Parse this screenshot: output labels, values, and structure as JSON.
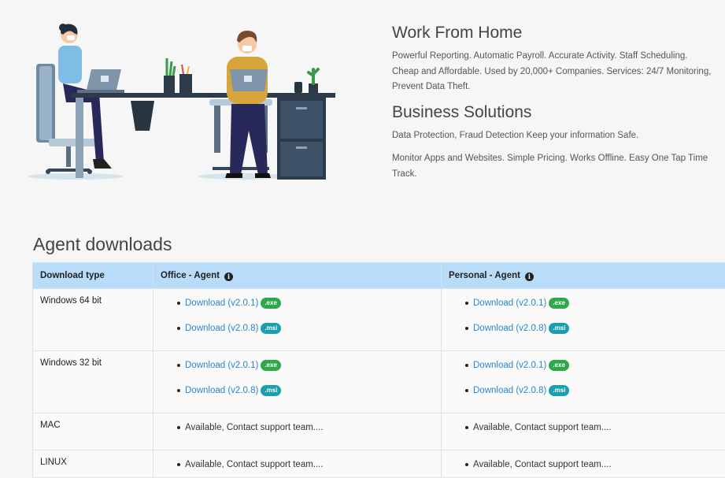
{
  "hero": {
    "heading_wfh": "Work From Home",
    "text_wfh": "Powerful Reporting. Automatic Payroll. Accurate Activity. Staff Scheduling. Cheap and Affordable. Used by 20,000+ Companies. Services: 24/7 Monitoring, Prevent Data Theft.",
    "heading_bs": "Business Solutions",
    "text_bs1": "Data Protection, Fraud Detection Keep your information Safe.",
    "text_bs2": "Monitor Apps and Websites. Simple Pricing. Works Offline. Easy One Tap Time Track."
  },
  "downloads": {
    "title": "Agent downloads",
    "headers": {
      "type": "Download type",
      "office": "Office - Agent",
      "personal": "Personal - Agent"
    },
    "rows": [
      {
        "type": "Windows 64 bit",
        "office": [
          {
            "label": "Download (v2.0.1)",
            "badge": ".exe"
          },
          {
            "label": "Download (v2.0.8)",
            "badge": ".msi"
          }
        ],
        "personal": [
          {
            "label": "Download (v2.0.1)",
            "badge": ".exe"
          },
          {
            "label": "Download (v2.0.8)",
            "badge": ".msi"
          }
        ]
      },
      {
        "type": "Windows 32 bit",
        "office": [
          {
            "label": "Download (v2.0.1)",
            "badge": ".exe"
          },
          {
            "label": "Download (v2.0.8)",
            "badge": ".msi"
          }
        ],
        "personal": [
          {
            "label": "Download (v2.0.1)",
            "badge": ".exe"
          },
          {
            "label": "Download (v2.0.8)",
            "badge": ".msi"
          }
        ]
      },
      {
        "type": "MAC",
        "office_note": "Available, Contact support team....",
        "personal_note": "Available, Contact support team...."
      },
      {
        "type": "LINUX",
        "office_note": "Available, Contact support team....",
        "personal_note": "Available, Contact support team...."
      }
    ]
  },
  "colors": {
    "header_bg": "#b9dcfa",
    "link": "#2a86c8",
    "badge_exe": "#2ea84a",
    "badge_msi": "#1b9fb0"
  },
  "icons": {
    "info": "info-circle-icon",
    "illustration": "work-from-home-illustration"
  }
}
